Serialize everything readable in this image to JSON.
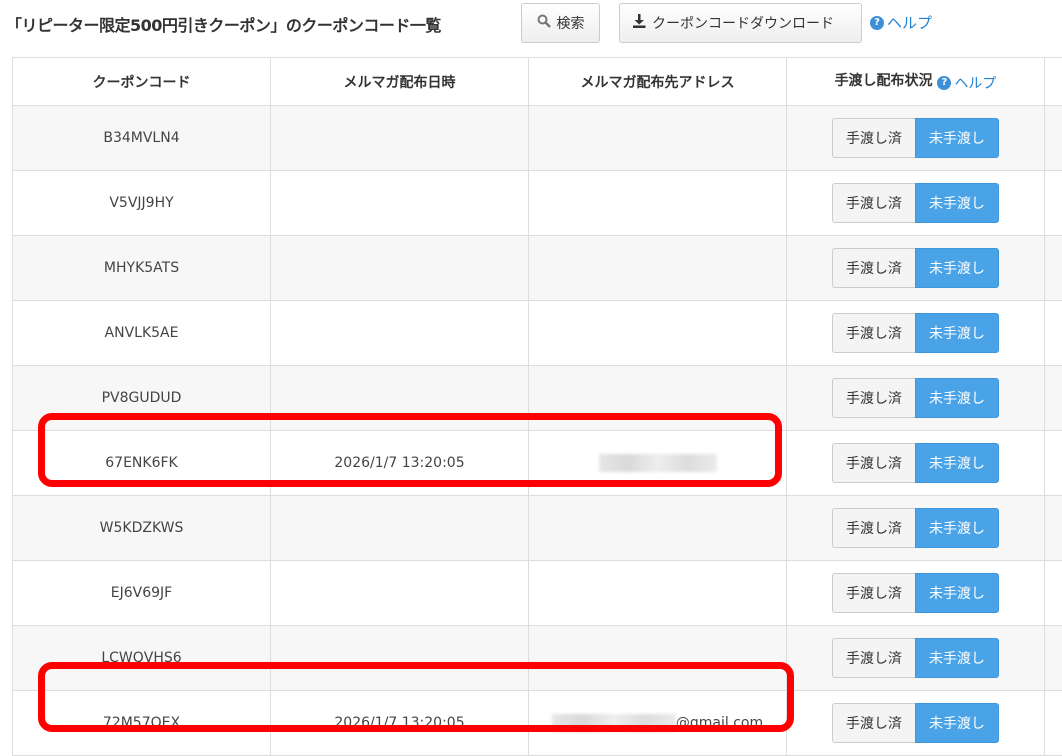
{
  "header": {
    "title": "「リピーター限定500円引きクーポン」のクーポンコード一覧",
    "search_label": "検索",
    "download_label": "クーポンコードダウンロード",
    "help_label": "ヘルプ"
  },
  "table": {
    "columns": [
      "クーポンコード",
      "メルマガ配布日時",
      "メルマガ配布先アドレス",
      "手渡し配布状況"
    ],
    "status_help": "ヘルプ",
    "toggle_done": "手渡し済",
    "toggle_not": "未手渡し",
    "rows": [
      {
        "code": "B34MVLN4",
        "date": "",
        "email": ""
      },
      {
        "code": "V5VJJ9HY",
        "date": "",
        "email": ""
      },
      {
        "code": "MHYK5ATS",
        "date": "",
        "email": ""
      },
      {
        "code": "ANVLK5AE",
        "date": "",
        "email": ""
      },
      {
        "code": "PV8GUDUD",
        "date": "",
        "email": ""
      },
      {
        "code": "67ENK6FK",
        "date": "2026/1/7 13:20:05",
        "email": ""
      },
      {
        "code": "W5KDZKWS",
        "date": "",
        "email": ""
      },
      {
        "code": "EJ6V69JF",
        "date": "",
        "email": ""
      },
      {
        "code": "LCWQVHS6",
        "date": "",
        "email": ""
      },
      {
        "code": "72M57QEX",
        "date": "2026/1/7 13:20:05",
        "email": "@gmail.com"
      }
    ]
  },
  "colors": {
    "accent_blue": "#4aa3e6",
    "link_blue": "#1e82d4",
    "highlight_red": "#ff0000"
  },
  "icons": {
    "search": "search-icon",
    "download": "download-icon",
    "help": "help-circle-icon"
  }
}
